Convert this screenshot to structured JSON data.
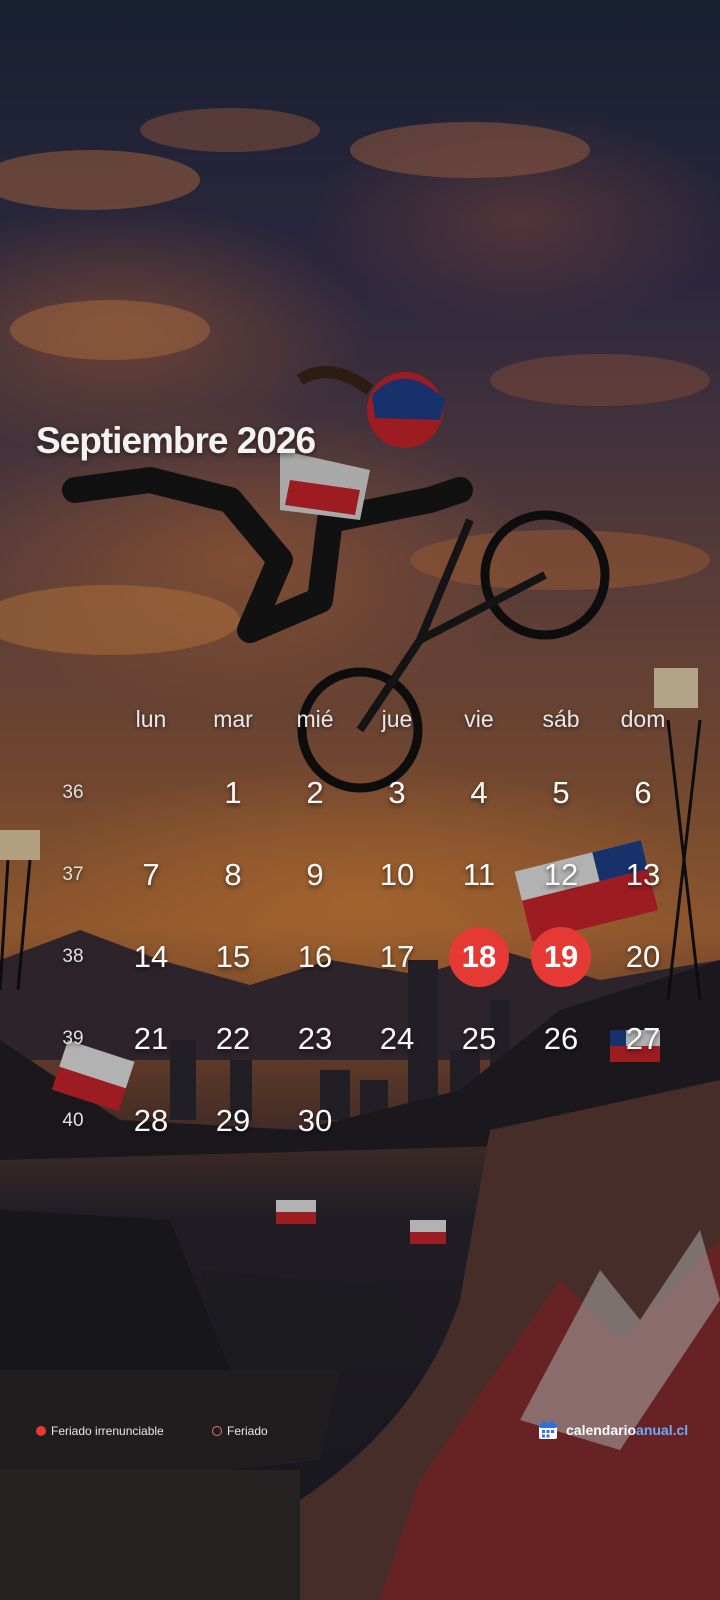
{
  "calendar": {
    "title": "Septiembre 2026",
    "weekdays": [
      "lun",
      "mar",
      "mié",
      "jue",
      "vie",
      "sáb",
      "dom"
    ],
    "weeks": [
      {
        "num": "36",
        "days": [
          "",
          "1",
          "2",
          "3",
          "4",
          "5",
          "6"
        ]
      },
      {
        "num": "37",
        "days": [
          "7",
          "8",
          "9",
          "10",
          "11",
          "12",
          "13"
        ]
      },
      {
        "num": "38",
        "days": [
          "14",
          "15",
          "16",
          "17",
          "18",
          "19",
          "20"
        ]
      },
      {
        "num": "39",
        "days": [
          "21",
          "22",
          "23",
          "24",
          "25",
          "26",
          "27"
        ]
      },
      {
        "num": "40",
        "days": [
          "28",
          "29",
          "30",
          "",
          "",
          "",
          ""
        ]
      }
    ],
    "holidays_strict": [
      "18",
      "19"
    ]
  },
  "legend": {
    "strict_label": "Feriado irrenunciable",
    "regular_label": "Feriado"
  },
  "brand": {
    "part1": "calendario",
    "part2": "anual.cl"
  },
  "colors": {
    "holiday_strict": "#e53935",
    "holiday_regular": "#e57373",
    "brand_accent": "#6ea8ff"
  }
}
